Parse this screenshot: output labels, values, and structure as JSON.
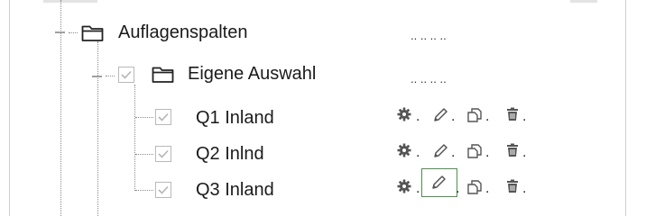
{
  "tree": {
    "root": {
      "label": "Auflagenspalten",
      "trailing": ".. .. .. .."
    },
    "group": {
      "label": "Eigene Auswahl",
      "checked": true,
      "trailing": ".. .. .. .."
    },
    "items": [
      {
        "label": "Q1 Inland",
        "checked": true
      },
      {
        "label": "Q2 Inlnd",
        "checked": true
      },
      {
        "label": "Q3 Inland",
        "checked": true
      }
    ],
    "actions": {
      "separator": ".",
      "icons": [
        "gear-icon",
        "pencil-icon",
        "copy-icon",
        "trash-icon"
      ]
    }
  },
  "colors": {
    "guide": "#8c8c8c",
    "checkbox_border": "#b9b9b9",
    "check_mark": "#b5b5b5",
    "icon": "#555555",
    "selected_border": "#4d8f4d"
  }
}
